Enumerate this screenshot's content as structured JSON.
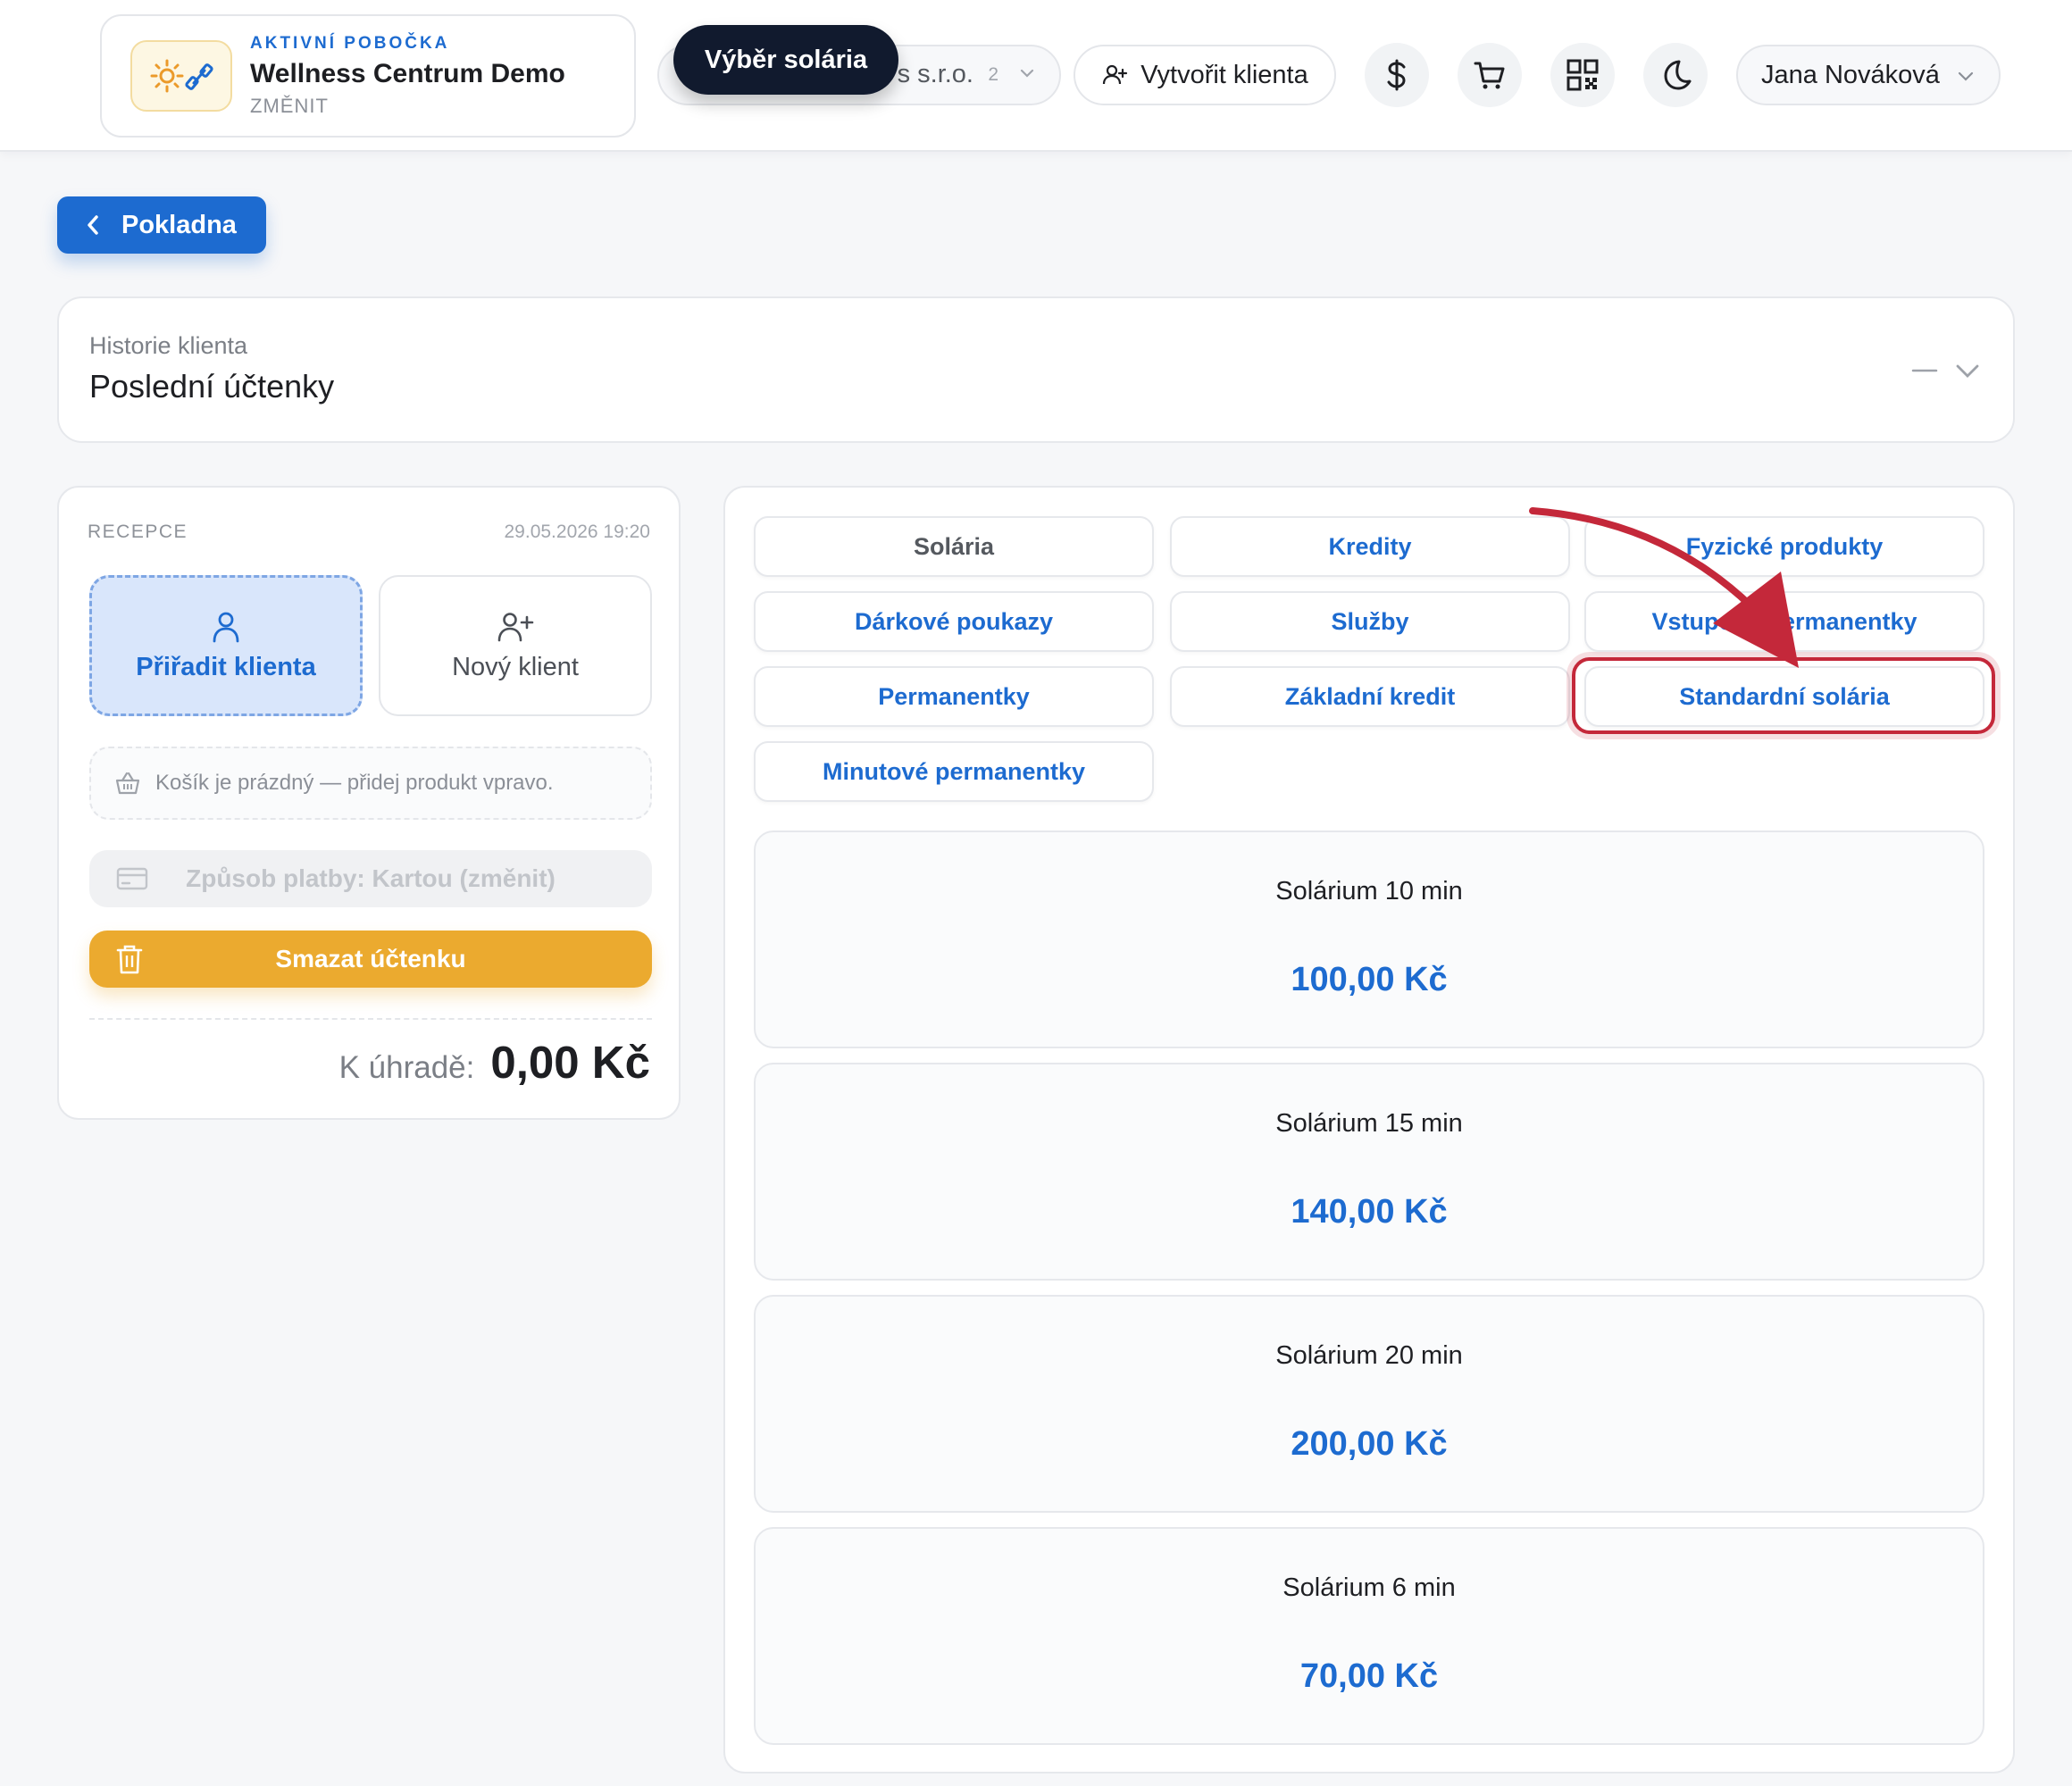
{
  "header": {
    "branch_kicker": "AKTIVNÍ POBOČKA",
    "branch_name": "Wellness Centrum Demo",
    "branch_change": "ZMĚNIT",
    "company_text": "s s.r.o.",
    "company_count": "2",
    "tooltip": "Výběr solária",
    "create_client": "Vytvořit klienta",
    "user_name": "Jana Nováková",
    "icons": [
      "dollar-icon",
      "cart-icon",
      "qr-code-icon",
      "moon-icon"
    ]
  },
  "back_button": "Pokladna",
  "history": {
    "label": "Historie klienta",
    "title": "Poslední účtenky"
  },
  "receipt": {
    "location": "RECEPCE",
    "datetime": "29.05.2026 19:20",
    "assign_client": "Přiřadit klienta",
    "new_client": "Nový klient",
    "cart_empty": "Košík je prázdný — přidej produkt vpravo.",
    "payment_method": "Způsob platby: Kartou (změnit)",
    "delete_receipt": "Smazat účtenku",
    "total_label": "K úhradě:",
    "total_value": "0,00 Kč"
  },
  "tabs": [
    "Solária",
    "Kredity",
    "Fyzické produkty",
    "Dárkové poukazy",
    "Služby",
    "Vstupové permanentky",
    "Permanentky",
    "Základní kredit",
    "Standardní solária",
    "Minutové permanentky"
  ],
  "products": [
    {
      "name": "Solárium 10 min",
      "price": "100,00 Kč"
    },
    {
      "name": "Solárium 15 min",
      "price": "140,00 Kč"
    },
    {
      "name": "Solárium 20 min",
      "price": "200,00 Kč"
    },
    {
      "name": "Solárium 6 min",
      "price": "70,00 Kč"
    }
  ],
  "colors": {
    "primary": "#1d6bd0",
    "accent": "#ebaa2f",
    "highlight": "#c4283a",
    "tooltip_bg": "#111a2e"
  }
}
